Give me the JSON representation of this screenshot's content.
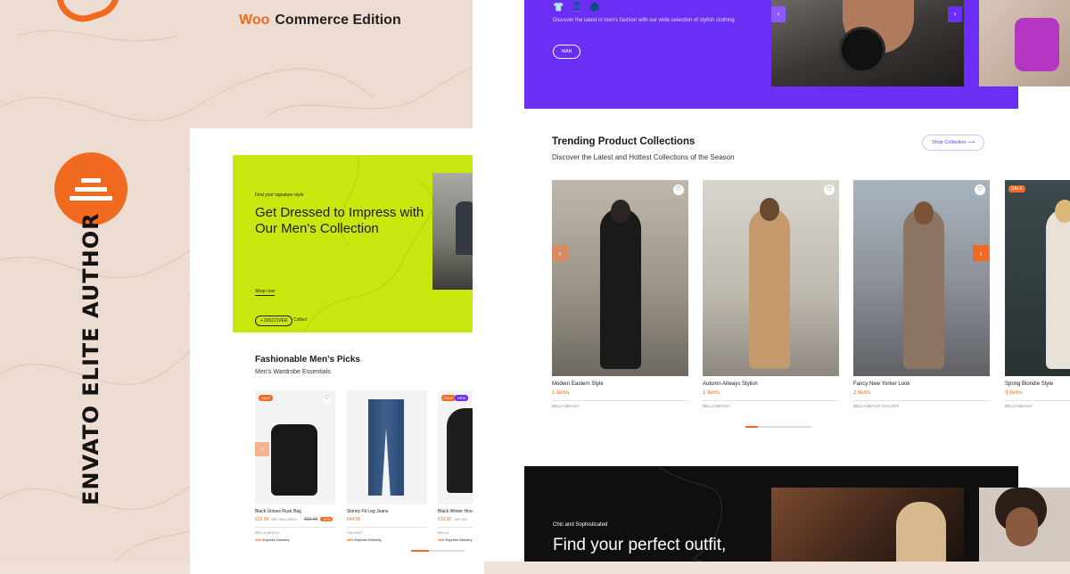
{
  "brand": {
    "edition_prefix": "Woo",
    "edition_text": "Commerce Edition",
    "accent": "#f06a1f",
    "purple": "#6a2ef5"
  },
  "author_badge": {
    "text": "ENVATO ELITE AUTHOR",
    "icon": "stack-lines-icon"
  },
  "left_mock": {
    "hero": {
      "eyebrow": "Find your signature style",
      "title": "Get Dressed to Impress with Our Men's Collection",
      "shop_now": "Shop now",
      "discover": "+ DISCOVER",
      "collect": "Collect"
    },
    "section_title": "Fashionable Men's Picks",
    "section_sub": "Men's Wardrobe Essentials",
    "products": [
      {
        "name": "Black Unisex Ruck Bag",
        "price": "€22.00",
        "vat": "VAT INCLUDED",
        "old": "€32.00",
        "off": "-31%",
        "brand": "BELLA BEACH",
        "delivery_tag": "48H",
        "delivery": "Express Delivery",
        "badge": "SALE"
      },
      {
        "name": "Skinny Fit Leg Jeans",
        "price": "€44.95",
        "vat": "",
        "old": "",
        "off": "",
        "brand": "CALLINIT",
        "delivery_tag": "48H",
        "delivery": "Express Delivery",
        "badge": ""
      },
      {
        "name": "Black Winter Hood",
        "price": "€19.00",
        "vat": "VAT INC",
        "old": "",
        "off": "",
        "brand": "BELLA",
        "delivery_tag": "48H",
        "delivery": "Express Delivery",
        "badge": "SALE",
        "badge2": "NEW"
      }
    ]
  },
  "right_mock": {
    "hero": {
      "subtitle": "Discover the latest in men's fashion with our wide selection of stylish clothing",
      "button": "MAN",
      "icons": [
        "tshirt-icon",
        "pants-icon",
        "jacket-icon"
      ],
      "icon_glyphs": [
        "👕",
        "👖",
        "🧥"
      ]
    },
    "nav": {
      "prev": "‹",
      "next": "›"
    },
    "trending_title": "Trending Product Collections",
    "trending_sub": "Discover the Latest and Hottest Collections of the Season",
    "shop_collection": "Shop Collection",
    "collections": [
      {
        "name": "Modern Eastern Style",
        "count": "1 items",
        "brand": "BELLA BEACH",
        "sale": ""
      },
      {
        "name": "Autumn Allways Stylish",
        "count": "1 items",
        "brand": "BELLA BEACH",
        "sale": ""
      },
      {
        "name": "Fancy New Yorker Look",
        "count": "2 items",
        "brand": "BELLA BEACH   CALLINIT",
        "sale": ""
      },
      {
        "name": "Spring Blondie Style",
        "count": "3 items",
        "brand": "BELLA BEACH",
        "sale": "SALE"
      }
    ],
    "dark": {
      "eyebrow": "Chic and Sophisticated",
      "title": "Find your perfect outfit,"
    }
  }
}
